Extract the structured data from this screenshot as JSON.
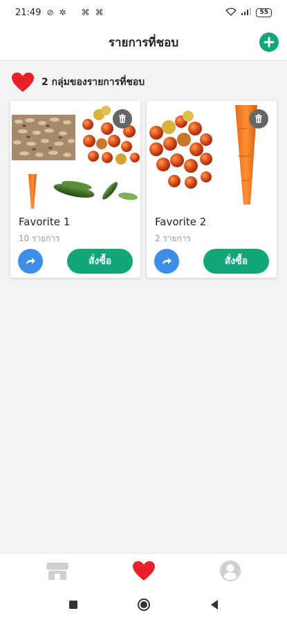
{
  "status_bar": {
    "time": "21:49",
    "battery": "55",
    "left_icons": [
      "notification-off-icon",
      "gear-icon",
      "app-icon",
      "app-icon"
    ],
    "right_icons": [
      "wifi-icon",
      "signal-icon",
      "battery-icon"
    ]
  },
  "header": {
    "title": "รายการที่ชอบ",
    "add_icon": "plus-circle-icon"
  },
  "summary": {
    "text": "2 กลุ่มของรายการที่ชอบ",
    "icon": "heart-icon"
  },
  "cards": [
    {
      "name": "Favorite 1",
      "count": "10 รายการ",
      "order_label": "สั่งซื้อ",
      "images": [
        "peanuts",
        "tomatoes",
        "carrot",
        "cucumbers"
      ]
    },
    {
      "name": "Favorite 2",
      "count": "2 รายการ",
      "order_label": "สั่งซื้อ",
      "images": [
        "tomatoes",
        "carrot"
      ]
    }
  ],
  "tab_bar": {
    "items": [
      {
        "icon": "store-icon",
        "active": false
      },
      {
        "icon": "heart-icon",
        "active": true
      },
      {
        "icon": "profile-icon",
        "active": false
      }
    ]
  },
  "nav_bar": {
    "items": [
      "recent-apps-icon",
      "home-icon",
      "back-icon"
    ]
  },
  "colors": {
    "accent": "#11a77a",
    "heart": "#e8202a",
    "share": "#3d8ee8",
    "background": "#f3f3f3"
  }
}
